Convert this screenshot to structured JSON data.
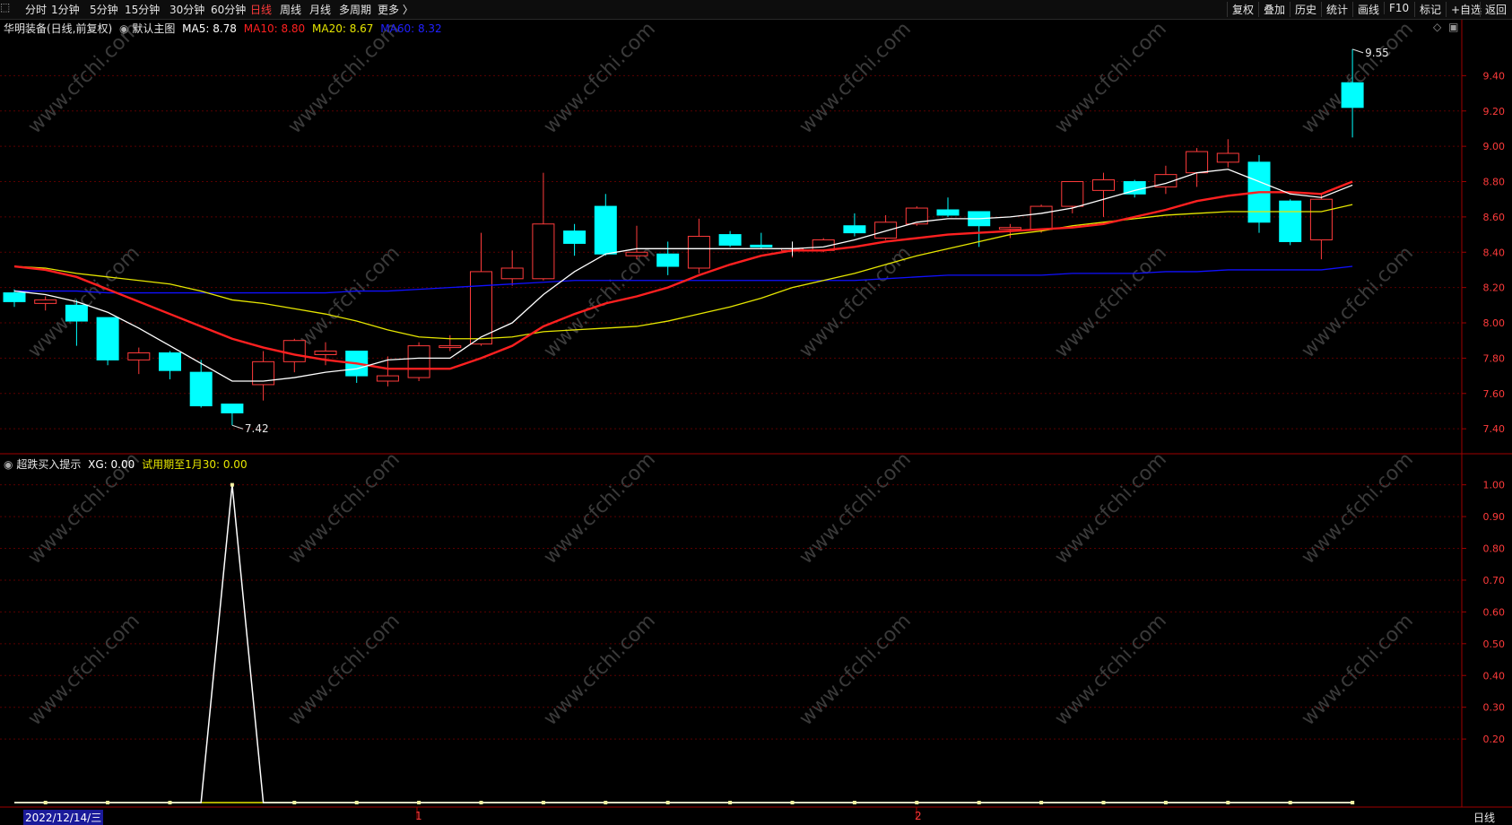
{
  "toolbar": {
    "left": [
      {
        "label": "分时",
        "active": false
      },
      {
        "label": "1分钟",
        "active": false
      },
      {
        "label": "5分钟",
        "active": false
      },
      {
        "label": "15分钟",
        "active": false
      },
      {
        "label": "30分钟",
        "active": false
      },
      {
        "label": "60分钟",
        "active": false
      },
      {
        "label": "日线",
        "active": true
      },
      {
        "label": "周线",
        "active": false
      },
      {
        "label": "月线",
        "active": false
      },
      {
        "label": "多周期",
        "active": false
      },
      {
        "label": "更多 〉",
        "active": false
      }
    ],
    "right": [
      "复权",
      "叠加",
      "历史",
      "统计",
      "画线",
      "F10",
      "标记",
      "+自选",
      "返回"
    ]
  },
  "main_header": {
    "stock": "华明装备(日线,前复权)",
    "template": "默认主图",
    "ma5": "MA5: 8.78",
    "ma10": "MA10: 8.80",
    "ma20": "MA20: 8.67",
    "ma60": "MA60: 8.32"
  },
  "sub_header": {
    "name": "超跌买入提示",
    "xg": "XG: 0.00",
    "trial": "试用期至1月30: 0.00"
  },
  "bottom": {
    "date": "2022/12/14/三",
    "period": "日线",
    "marker_1": "1",
    "marker_2": "2"
  },
  "watermark": "www.cfchi.com",
  "colors": {
    "up": "#ff3b3b",
    "down": "#00ffff",
    "ma5": "#ffffff",
    "ma10": "#ff2020",
    "ma20": "#e6e600",
    "ma60": "#1010ff",
    "indicator": "#ffffff",
    "baseline": "#e6e600",
    "grid": "#5a0000"
  },
  "chart_data": [
    {
      "type": "candlestick",
      "title": "华明装备(日线,前复权)",
      "ylim": [
        7.35,
        9.6
      ],
      "yticks": [
        7.4,
        7.6,
        7.8,
        8.0,
        8.2,
        8.4,
        8.6,
        8.8,
        9.0,
        9.2,
        9.4
      ],
      "ytick_labels": [
        "7.40",
        "7.60",
        "7.80",
        "8.00",
        "8.20",
        "8.40",
        "8.60",
        "8.80",
        "9.00",
        "9.20",
        "9.40"
      ],
      "candles": [
        {
          "o": 8.17,
          "h": 8.19,
          "l": 8.09,
          "c": 8.12
        },
        {
          "o": 8.11,
          "h": 8.15,
          "l": 8.07,
          "c": 8.13
        },
        {
          "o": 8.1,
          "h": 8.13,
          "l": 7.87,
          "c": 8.01
        },
        {
          "o": 8.03,
          "h": 8.03,
          "l": 7.76,
          "c": 7.79
        },
        {
          "o": 7.79,
          "h": 7.86,
          "l": 7.71,
          "c": 7.83
        },
        {
          "o": 7.83,
          "h": 7.84,
          "l": 7.68,
          "c": 7.73
        },
        {
          "o": 7.72,
          "h": 7.79,
          "l": 7.52,
          "c": 7.53
        },
        {
          "o": 7.54,
          "h": 7.54,
          "l": 7.42,
          "c": 7.49
        },
        {
          "o": 7.65,
          "h": 7.84,
          "l": 7.56,
          "c": 7.78
        },
        {
          "o": 7.78,
          "h": 7.91,
          "l": 7.72,
          "c": 7.9
        },
        {
          "o": 7.82,
          "h": 7.89,
          "l": 7.76,
          "c": 7.84
        },
        {
          "o": 7.84,
          "h": 7.84,
          "l": 7.66,
          "c": 7.7
        },
        {
          "o": 7.67,
          "h": 7.81,
          "l": 7.64,
          "c": 7.7
        },
        {
          "o": 7.69,
          "h": 7.89,
          "l": 7.67,
          "c": 7.87
        },
        {
          "o": 7.86,
          "h": 7.93,
          "l": 7.84,
          "c": 7.87
        },
        {
          "o": 7.88,
          "h": 8.51,
          "l": 7.87,
          "c": 8.29
        },
        {
          "o": 8.25,
          "h": 8.41,
          "l": 8.21,
          "c": 8.31
        },
        {
          "o": 8.25,
          "h": 8.85,
          "l": 8.24,
          "c": 8.56
        },
        {
          "o": 8.52,
          "h": 8.56,
          "l": 8.38,
          "c": 8.45
        },
        {
          "o": 8.66,
          "h": 8.73,
          "l": 8.38,
          "c": 8.39
        },
        {
          "o": 8.38,
          "h": 8.55,
          "l": 8.36,
          "c": 8.4
        },
        {
          "o": 8.39,
          "h": 8.46,
          "l": 8.27,
          "c": 8.32
        },
        {
          "o": 8.31,
          "h": 8.59,
          "l": 8.28,
          "c": 8.49
        },
        {
          "o": 8.5,
          "h": 8.52,
          "l": 8.43,
          "c": 8.44
        },
        {
          "o": 8.44,
          "h": 8.51,
          "l": 8.42,
          "c": 8.43
        },
        {
          "o": 8.41,
          "h": 8.45,
          "l": 8.37,
          "c": 8.42
        },
        {
          "o": 8.41,
          "h": 8.48,
          "l": 8.4,
          "c": 8.47
        },
        {
          "o": 8.55,
          "h": 8.62,
          "l": 8.49,
          "c": 8.51
        },
        {
          "o": 8.48,
          "h": 8.61,
          "l": 8.47,
          "c": 8.57
        },
        {
          "o": 8.56,
          "h": 8.66,
          "l": 8.55,
          "c": 8.65
        },
        {
          "o": 8.64,
          "h": 8.71,
          "l": 8.6,
          "c": 8.61
        },
        {
          "o": 8.63,
          "h": 8.63,
          "l": 8.43,
          "c": 8.55
        },
        {
          "o": 8.53,
          "h": 8.56,
          "l": 8.48,
          "c": 8.54
        },
        {
          "o": 8.53,
          "h": 8.67,
          "l": 8.51,
          "c": 8.66
        },
        {
          "o": 8.66,
          "h": 8.8,
          "l": 8.62,
          "c": 8.8
        },
        {
          "o": 8.75,
          "h": 8.85,
          "l": 8.6,
          "c": 8.81
        },
        {
          "o": 8.8,
          "h": 8.81,
          "l": 8.71,
          "c": 8.73
        },
        {
          "o": 8.77,
          "h": 8.89,
          "l": 8.73,
          "c": 8.84
        },
        {
          "o": 8.85,
          "h": 8.99,
          "l": 8.77,
          "c": 8.97
        },
        {
          "o": 8.91,
          "h": 9.04,
          "l": 8.88,
          "c": 8.96
        },
        {
          "o": 8.91,
          "h": 8.95,
          "l": 8.51,
          "c": 8.57
        },
        {
          "o": 8.69,
          "h": 8.7,
          "l": 8.44,
          "c": 8.46
        },
        {
          "o": 8.47,
          "h": 8.73,
          "l": 8.36,
          "c": 8.7
        },
        {
          "o": 9.36,
          "h": 9.55,
          "l": 9.05,
          "c": 9.22
        }
      ],
      "ma5": [
        8.18,
        8.16,
        8.12,
        8.06,
        7.97,
        7.87,
        7.77,
        7.67,
        7.67,
        7.69,
        7.72,
        7.74,
        7.79,
        7.8,
        7.8,
        7.92,
        8.0,
        8.16,
        8.29,
        8.39,
        8.42,
        8.42,
        8.42,
        8.42,
        8.42,
        8.42,
        8.43,
        8.47,
        8.52,
        8.57,
        8.59,
        8.59,
        8.6,
        8.62,
        8.65,
        8.7,
        8.75,
        8.79,
        8.85,
        8.87,
        8.8,
        8.73,
        8.71,
        8.78
      ],
      "ma10": [
        8.32,
        8.3,
        8.26,
        8.19,
        8.12,
        8.05,
        7.98,
        7.91,
        7.86,
        7.82,
        7.79,
        7.77,
        7.74,
        7.74,
        7.74,
        7.8,
        7.87,
        7.98,
        8.05,
        8.11,
        8.15,
        8.2,
        8.27,
        8.33,
        8.38,
        8.41,
        8.41,
        8.43,
        8.46,
        8.48,
        8.5,
        8.51,
        8.52,
        8.53,
        8.54,
        8.56,
        8.6,
        8.64,
        8.69,
        8.72,
        8.74,
        8.74,
        8.73,
        8.8
      ],
      "ma20": [
        8.32,
        8.31,
        8.28,
        8.26,
        8.24,
        8.22,
        8.18,
        8.13,
        8.11,
        8.08,
        8.05,
        8.01,
        7.96,
        7.92,
        7.91,
        7.91,
        7.92,
        7.95,
        7.96,
        7.97,
        7.98,
        8.01,
        8.05,
        8.09,
        8.14,
        8.2,
        8.24,
        8.28,
        8.33,
        8.38,
        8.42,
        8.46,
        8.5,
        8.52,
        8.55,
        8.57,
        8.59,
        8.61,
        8.62,
        8.63,
        8.63,
        8.63,
        8.63,
        8.67
      ],
      "ma60": [
        8.18,
        8.18,
        8.18,
        8.17,
        8.17,
        8.17,
        8.17,
        8.17,
        8.17,
        8.17,
        8.17,
        8.18,
        8.18,
        8.19,
        8.2,
        8.21,
        8.22,
        8.23,
        8.24,
        8.24,
        8.24,
        8.24,
        8.24,
        8.24,
        8.24,
        8.24,
        8.24,
        8.24,
        8.25,
        8.26,
        8.27,
        8.27,
        8.27,
        8.27,
        8.28,
        8.28,
        8.28,
        8.29,
        8.29,
        8.3,
        8.3,
        8.3,
        8.3,
        8.32
      ],
      "annotations": [
        {
          "label": "9.55",
          "candle": 43,
          "price": 9.55
        },
        {
          "label": "7.42",
          "candle": 7,
          "price": 7.42
        }
      ]
    },
    {
      "type": "line",
      "title": "超跌买入提示",
      "ylim": [
        0,
        1.03
      ],
      "yticks": [
        0.2,
        0.3,
        0.4,
        0.5,
        0.6,
        0.7,
        0.8,
        0.9,
        1.0
      ],
      "ytick_labels": [
        "0.20",
        "0.30",
        "0.40",
        "0.50",
        "0.60",
        "0.70",
        "0.80",
        "0.90",
        "1.00"
      ],
      "series": [
        {
          "values": [
            0,
            0,
            0,
            0,
            0,
            0,
            0,
            1,
            0,
            0,
            0,
            0,
            0,
            0,
            0,
            0,
            0,
            0,
            0,
            0,
            0,
            0,
            0,
            0,
            0,
            0,
            0,
            0,
            0,
            0,
            0,
            0,
            0,
            0,
            0,
            0,
            0,
            0,
            0,
            0,
            0,
            0,
            0,
            0
          ]
        }
      ]
    }
  ]
}
